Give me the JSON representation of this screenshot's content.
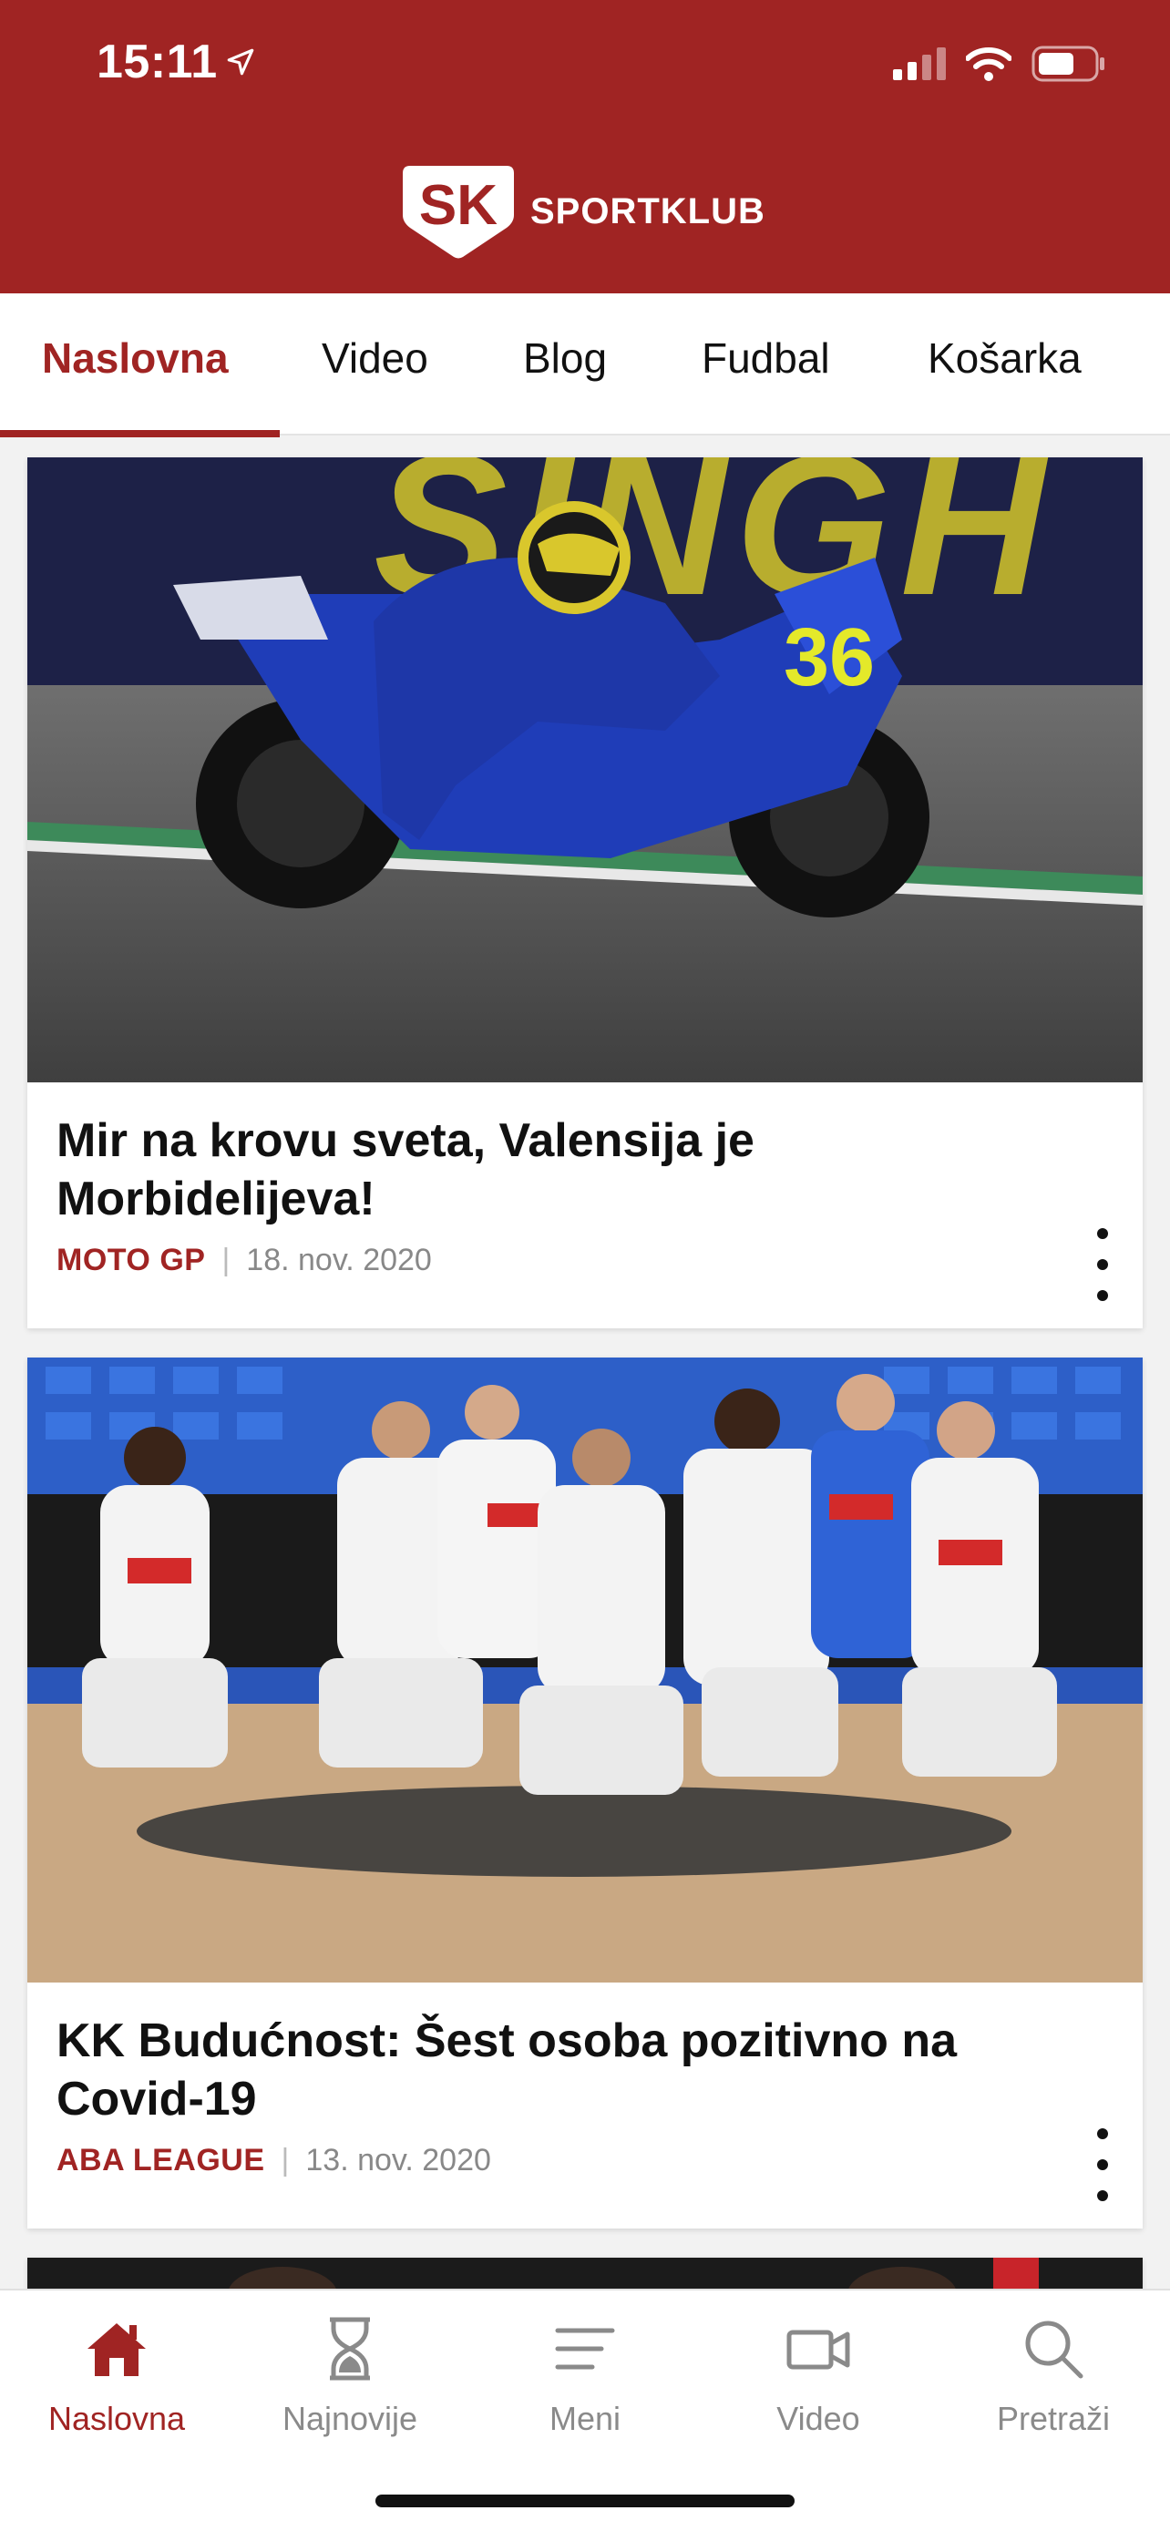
{
  "status": {
    "time": "15:11"
  },
  "brand": {
    "logo_letters": "SK",
    "name": "SPORTKLUB",
    "color": "#a02423"
  },
  "tabs": [
    {
      "label": "Naslovna",
      "active": true
    },
    {
      "label": "Video",
      "active": false
    },
    {
      "label": "Blog",
      "active": false
    },
    {
      "label": "Fudbal",
      "active": false
    },
    {
      "label": "Košarka",
      "active": false
    }
  ],
  "articles": [
    {
      "title": "Mir na krovu sveta, Valensija je Morbidelijeva!",
      "category": "MOTO GP",
      "date": "18. nov. 2020",
      "image": "motogp-rider-photo"
    },
    {
      "title": "KK Budućnost: Šest osoba pozitivno na Covid-19",
      "category": "ABA LEAGUE",
      "date": "13. nov. 2020",
      "image": "basketball-team-photo"
    }
  ],
  "bottom_nav": [
    {
      "label": "Naslovna",
      "icon": "home-icon",
      "active": true
    },
    {
      "label": "Najnovije",
      "icon": "hourglass-icon",
      "active": false
    },
    {
      "label": "Meni",
      "icon": "menu-icon",
      "active": false
    },
    {
      "label": "Video",
      "icon": "video-camera-icon",
      "active": false
    },
    {
      "label": "Pretraži",
      "icon": "search-icon",
      "active": false
    }
  ]
}
